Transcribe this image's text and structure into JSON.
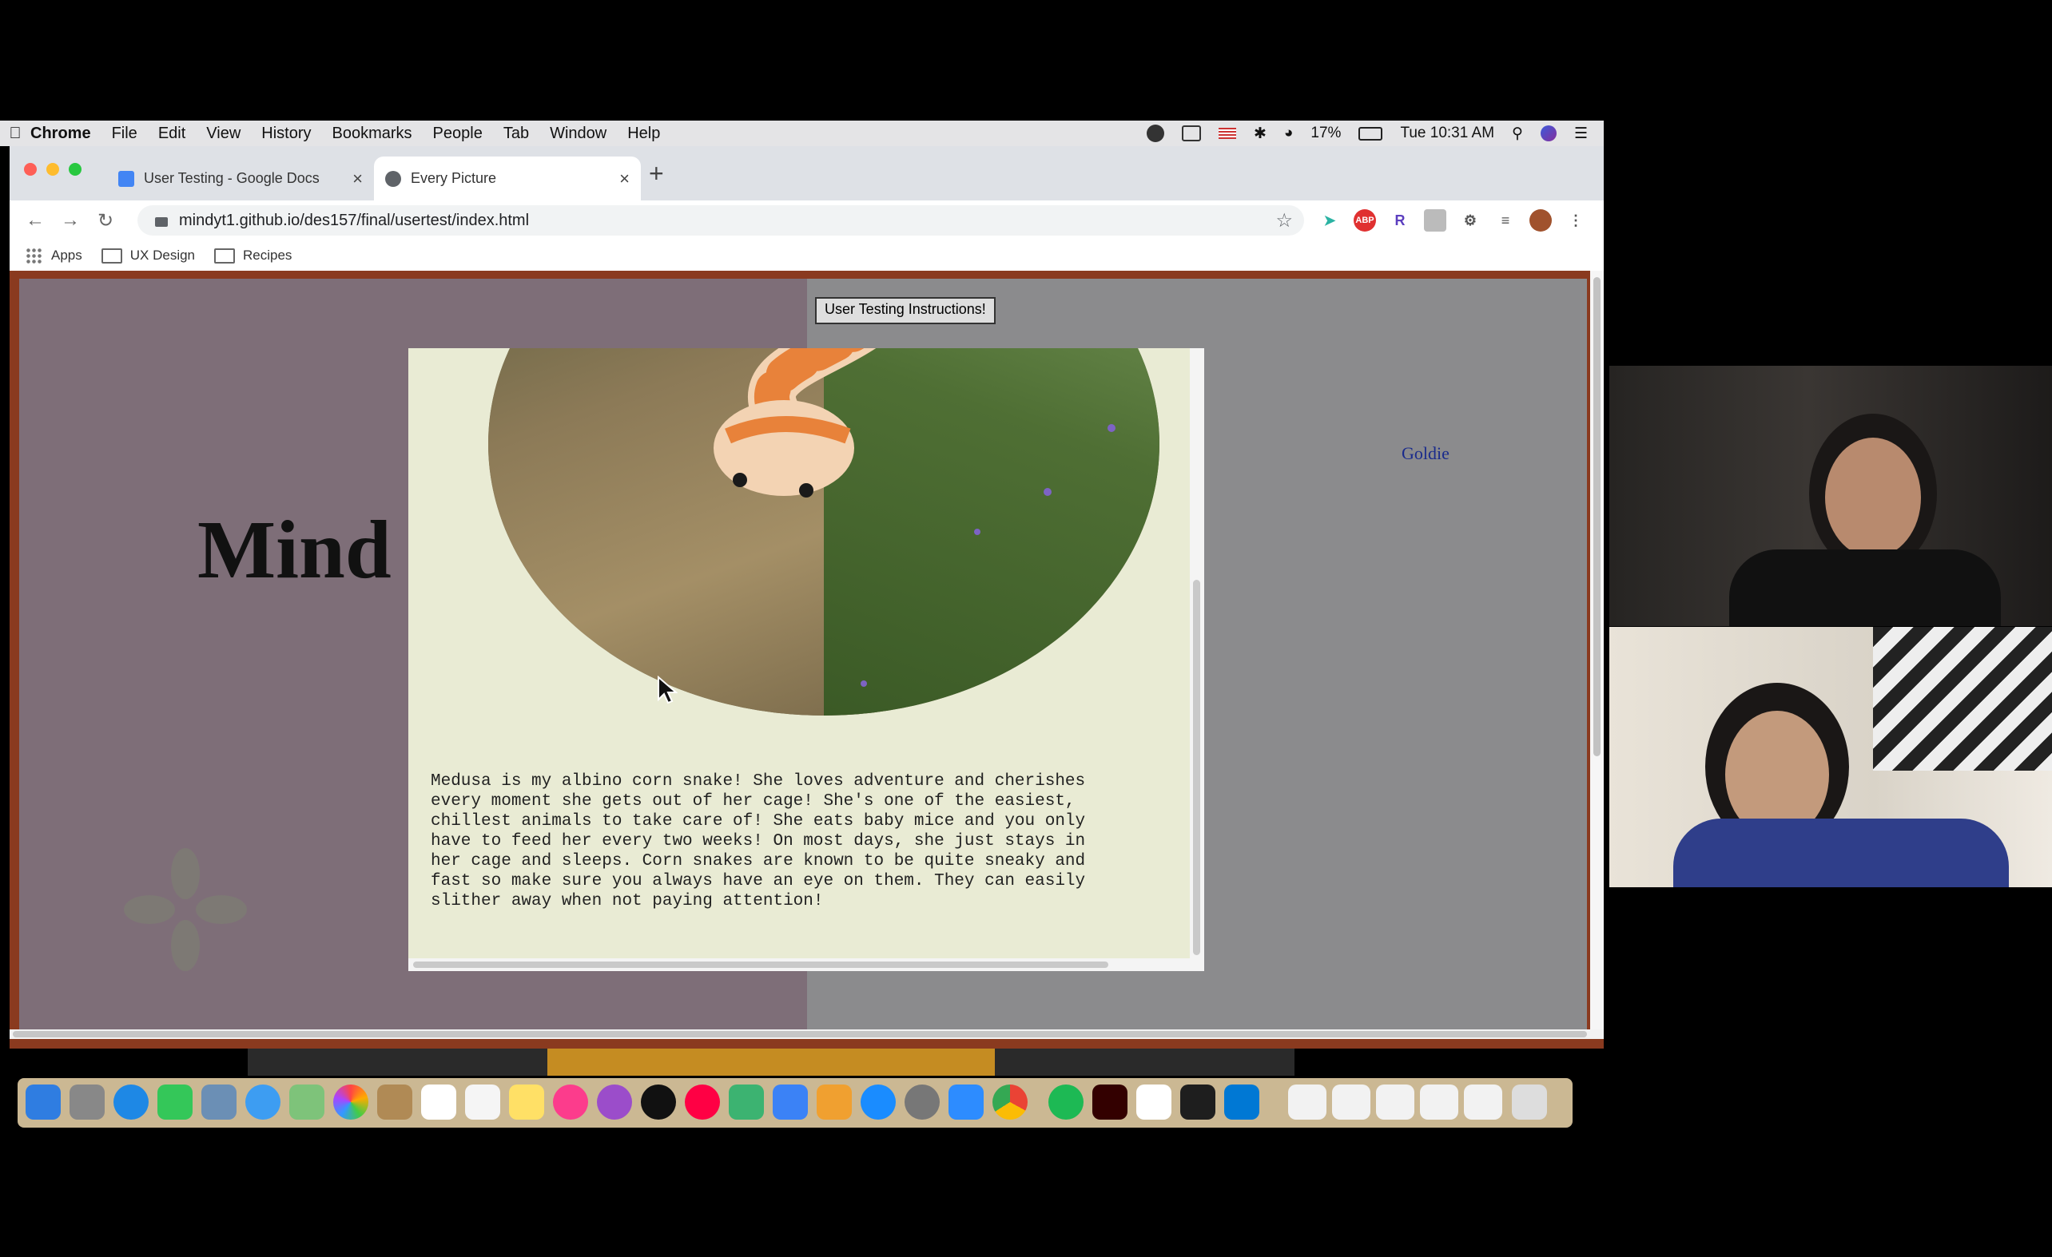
{
  "menubar": {
    "app": "Chrome",
    "items": [
      "File",
      "Edit",
      "View",
      "History",
      "Bookmarks",
      "People",
      "Tab",
      "Window",
      "Help"
    ],
    "battery": "17%",
    "clock": "Tue 10:31 AM"
  },
  "browser": {
    "tabs": [
      {
        "title": "User Testing - Google Docs",
        "active": false
      },
      {
        "title": "Every Picture",
        "active": true
      }
    ],
    "url": "mindyt1.github.io/des157/final/usertest/index.html",
    "bookmarks": [
      "Apps",
      "UX Design",
      "Recipes"
    ]
  },
  "page": {
    "instructions_button": "User Testing Instructions!",
    "heading_partial": "Mind",
    "nav_link": "Goldie",
    "modal_text": "Medusa is my albino corn snake! She loves adventure and cherishes\nevery moment she gets out of her cage! She's one of the easiest,\nchillest animals to take care of! She eats baby mice and you only\nhave to feed her every two weeks! On most days, she just stays in\nher cage and sleeps. Corn snakes are known to be quite sneaky and\nfast so make sure you always have an eye on them. They can easily\nslither away when not paying attention!"
  },
  "colors": {
    "page_border": "#8a3a1f",
    "left_panel": "#7e6e78",
    "right_panel": "#8b8b8d",
    "modal_bg": "#e9ebd4",
    "snake_orange": "#e8823a",
    "snake_cream": "#f3d3b3"
  }
}
